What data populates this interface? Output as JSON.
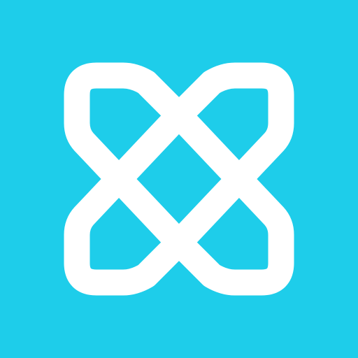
{
  "icon": {
    "name": "interlocking-loops-logo",
    "background_color": "#1ECDEA",
    "foreground_color": "#FFFFFF"
  }
}
